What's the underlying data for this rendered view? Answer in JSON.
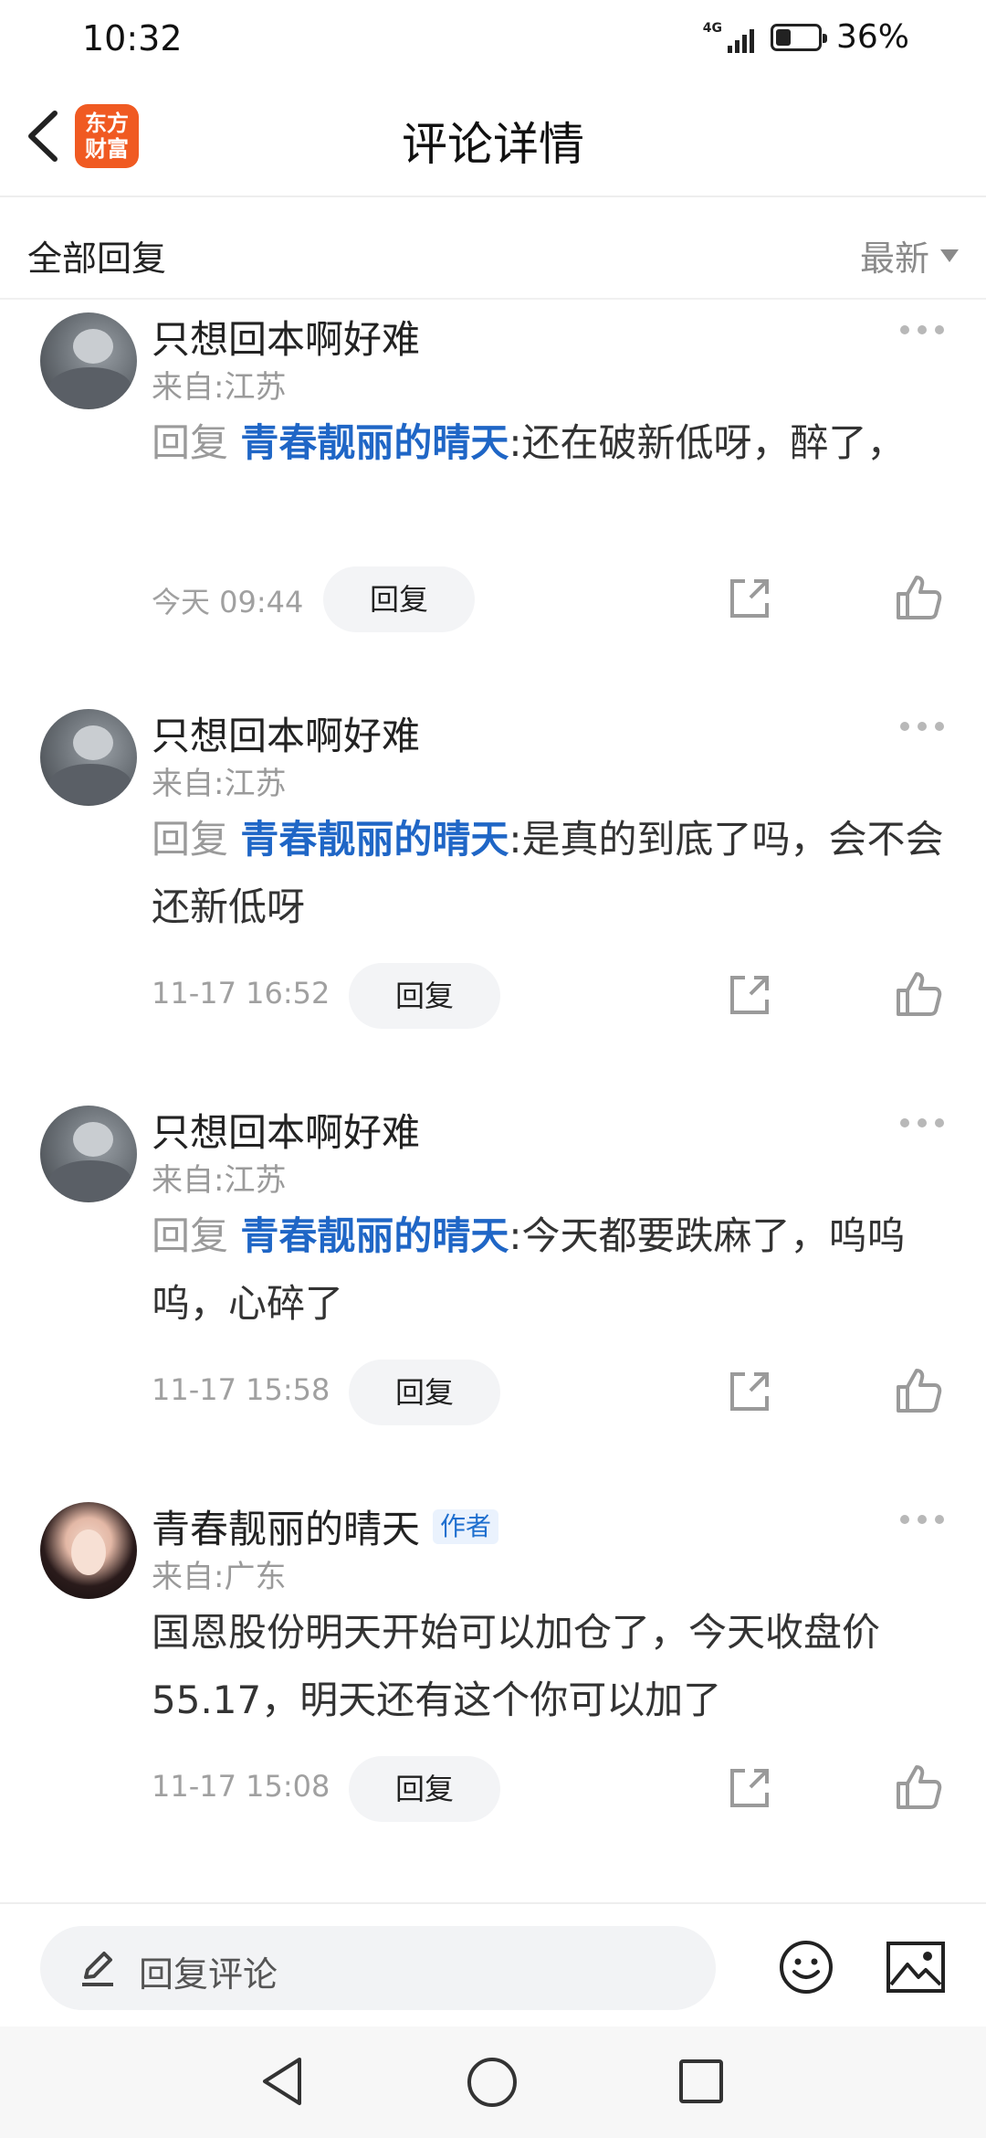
{
  "status_bar": {
    "time": "10:32",
    "network": "4G",
    "battery_level": 0.36,
    "battery_text": "36%"
  },
  "header": {
    "title": "评论详情",
    "logo_line1": "东方",
    "logo_line2": "财富",
    "logo_color": "#f05a22"
  },
  "subheader": {
    "label": "全部回复",
    "sort": "最新"
  },
  "comments": [
    {
      "user": "只想回本啊好难",
      "from": "来自:江苏",
      "reply_word": "回复",
      "mention": "青春靓丽的晴天",
      "text": ":还在破新低呀，醉了，",
      "time": "今天 09:44",
      "reply_button": "回复"
    },
    {
      "user": "只想回本啊好难",
      "from": "来自:江苏",
      "reply_word": "回复",
      "mention": "青春靓丽的晴天",
      "text": ":是真的到底了吗，会不会还新低呀",
      "time": "11-17 16:52",
      "reply_button": "回复"
    },
    {
      "user": "只想回本啊好难",
      "from": "来自:江苏",
      "reply_word": "回复",
      "mention": "青春靓丽的晴天",
      "text": ":今天都要跌麻了，呜呜呜，心碎了",
      "time": "11-17 15:58",
      "reply_button": "回复"
    },
    {
      "user": "青春靓丽的晴天",
      "author_tag": "作者",
      "from": "来自:广东",
      "text": "国恩股份明天开始可以加仓了，今天收盘价55.17，明天还有这个你可以加了",
      "time": "11-17 15:08",
      "reply_button": "回复"
    }
  ],
  "input_bar": {
    "placeholder": "回复评论"
  },
  "icons": {
    "back": "back-arrow-icon",
    "more": "more-dots-icon",
    "share": "share-icon",
    "like": "thumbs-up-icon",
    "pen": "pen-icon",
    "emoji": "emoji-icon",
    "image": "image-icon"
  },
  "colors": {
    "mention": "#1f66c6",
    "author_tag": "#1e6fcf"
  }
}
